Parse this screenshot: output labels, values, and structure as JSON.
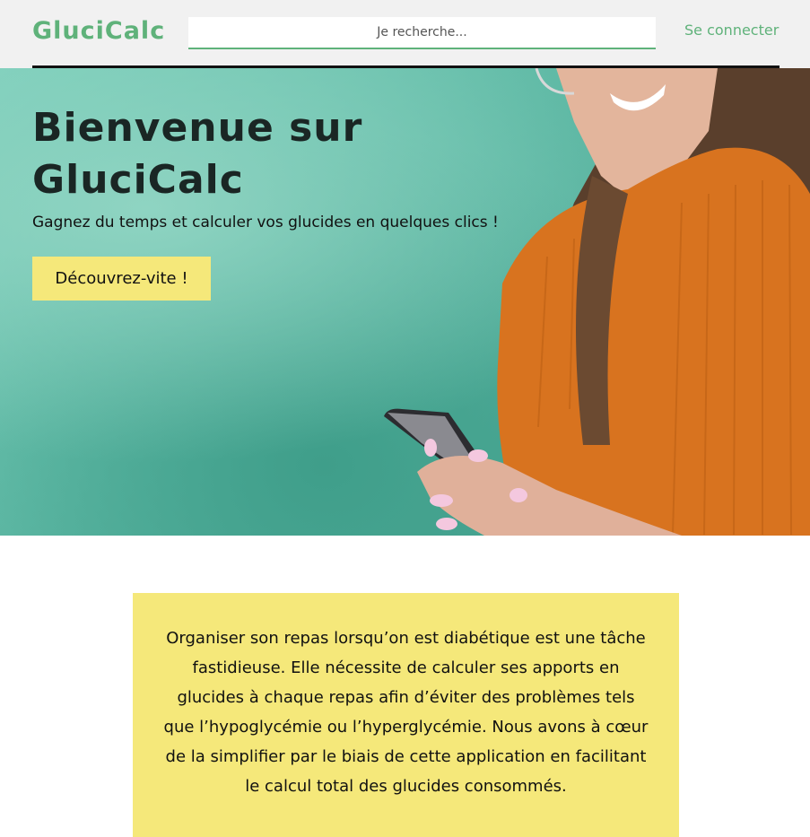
{
  "header": {
    "logo": "GluciCalc",
    "search_placeholder": "Je recherche...",
    "login_label": "Se connecter"
  },
  "hero": {
    "title_line1": "Bienvenue sur",
    "title_line2": "GluciCalc",
    "subtitle": "Gagnez du temps et calculer vos glucides en quelques clics !",
    "cta_label": "Découvrez-vite !"
  },
  "intro": {
    "text": "Organiser son repas lorsqu’on est diabétique est une tâche fastidieuse. Elle nécessite de calculer ses apports en glucides à chaque repas afin d’éviter des problèmes tels que l’hypoglycémie ou l’hyperglycémie. Nous avons à cœur de la simplifier par le biais de cette application en facilitant le calcul total des glucides consommés."
  },
  "colors": {
    "brand_green": "#5fb27a",
    "accent_yellow": "#f5e87a",
    "hero_teal": "#5db8a4",
    "sweater_orange": "#d8731f"
  }
}
